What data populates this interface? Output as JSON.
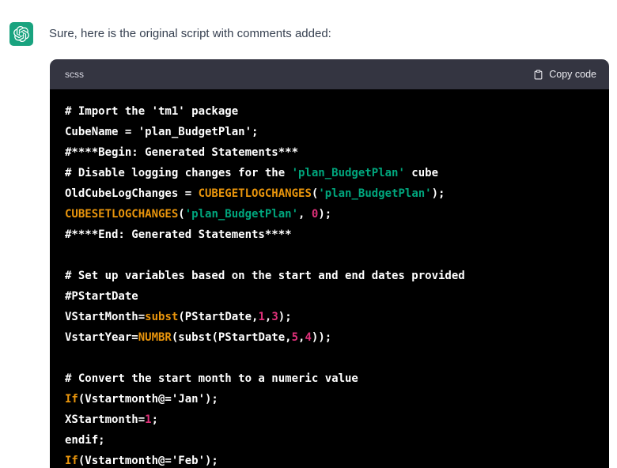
{
  "message": {
    "text": "Sure, here is the original script with comments added:",
    "avatar_icon": "openai-logo"
  },
  "code_block": {
    "language": "scss",
    "copy_button": {
      "icon": "clipboard",
      "label": "Copy code"
    },
    "lines": [
      [
        {
          "t": "# Import the 'tm1' package",
          "c": "plain"
        }
      ],
      [
        {
          "t": "CubeName = 'plan_BudgetPlan';",
          "c": "plain"
        }
      ],
      [
        {
          "t": "#****Begin: Generated Statements***",
          "c": "plain"
        }
      ],
      [
        {
          "t": "# Disable logging changes for the ",
          "c": "plain"
        },
        {
          "t": "'plan_BudgetPlan'",
          "c": "string"
        },
        {
          "t": " cube",
          "c": "plain"
        }
      ],
      [
        {
          "t": "OldCubeLogChanges = ",
          "c": "plain"
        },
        {
          "t": "CUBEGETLOGCHANGES",
          "c": "builtin"
        },
        {
          "t": "(",
          "c": "plain"
        },
        {
          "t": "'plan_BudgetPlan'",
          "c": "string"
        },
        {
          "t": ");",
          "c": "plain"
        }
      ],
      [
        {
          "t": "CUBESETLOGCHANGES",
          "c": "builtin"
        },
        {
          "t": "(",
          "c": "plain"
        },
        {
          "t": "'plan_BudgetPlan'",
          "c": "string"
        },
        {
          "t": ", ",
          "c": "plain"
        },
        {
          "t": "0",
          "c": "number"
        },
        {
          "t": ");",
          "c": "plain"
        }
      ],
      [
        {
          "t": "#****End: Generated Statements****",
          "c": "plain"
        }
      ],
      [],
      [
        {
          "t": "# Set up variables based on the start and end dates provided",
          "c": "plain"
        }
      ],
      [
        {
          "t": "#PStartDate",
          "c": "plain"
        }
      ],
      [
        {
          "t": "VStartMonth=",
          "c": "plain"
        },
        {
          "t": "subst",
          "c": "builtin"
        },
        {
          "t": "(PStartDate,",
          "c": "plain"
        },
        {
          "t": "1",
          "c": "number"
        },
        {
          "t": ",",
          "c": "plain"
        },
        {
          "t": "3",
          "c": "number"
        },
        {
          "t": ");",
          "c": "plain"
        }
      ],
      [
        {
          "t": "VstartYear=",
          "c": "plain"
        },
        {
          "t": "NUMBR",
          "c": "builtin"
        },
        {
          "t": "(subst(PStartDate,",
          "c": "plain"
        },
        {
          "t": "5",
          "c": "number"
        },
        {
          "t": ",",
          "c": "plain"
        },
        {
          "t": "4",
          "c": "number"
        },
        {
          "t": "));",
          "c": "plain"
        }
      ],
      [],
      [
        {
          "t": "# Convert the start month to a numeric value",
          "c": "plain"
        }
      ],
      [
        {
          "t": "If",
          "c": "builtin"
        },
        {
          "t": "(Vstartmonth@='Jan');",
          "c": "plain"
        }
      ],
      [
        {
          "t": "XStartmonth=",
          "c": "plain"
        },
        {
          "t": "1",
          "c": "number"
        },
        {
          "t": ";",
          "c": "plain"
        }
      ],
      [
        {
          "t": "endif;",
          "c": "plain"
        }
      ],
      [
        {
          "t": "If",
          "c": "builtin"
        },
        {
          "t": "(Vstartmonth@='Feb');",
          "c": "plain"
        }
      ]
    ]
  },
  "colors": {
    "page-bg": "#ffffff",
    "message-text": "#374151",
    "avatar-bg": "#19a37f",
    "header-bg": "#343541",
    "header-text": "#d9d9e3",
    "copy-text": "#ececf1",
    "code-bg": "#000000",
    "code-plain": "#ffffff",
    "code-string": "#00a67d",
    "code-builtin": "#e9950c",
    "code-number": "#df3079"
  }
}
